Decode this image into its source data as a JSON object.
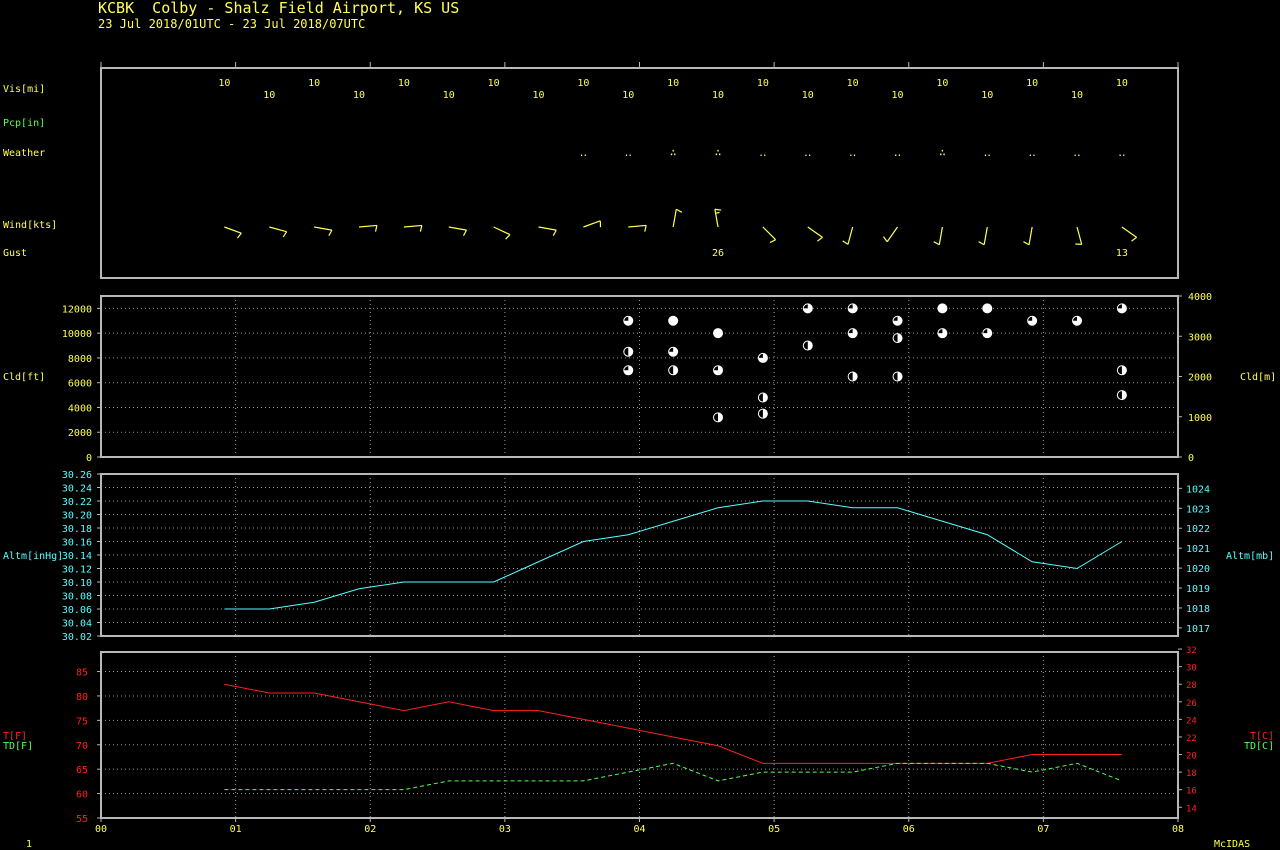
{
  "header": {
    "title": "KCBK  Colby - Shalz Field Airport, KS US",
    "subtitle": "23 Jul 2018/01UTC - 23 Jul 2018/07UTC"
  },
  "footer": {
    "left": "1",
    "right": "McIDAS"
  },
  "colors": {
    "yellow": "#ffff55",
    "green": "#55ff55",
    "cyan": "#55ffff",
    "red": "#ff2020",
    "frame": "#b8b8b8",
    "grid": "#9a9a9a"
  },
  "chart_data": {
    "type": "meteogram",
    "x": {
      "ticks": [
        "00",
        "01",
        "02",
        "03",
        "04",
        "05",
        "06",
        "07",
        "08"
      ],
      "obs_times": [
        0.9167,
        1.25,
        1.5833,
        1.9167,
        2.25,
        2.5833,
        2.9167,
        3.25,
        3.5833,
        3.9167,
        4.25,
        4.5833,
        4.9167,
        5.25,
        5.5833,
        5.9167,
        6.25,
        6.5833,
        6.9167,
        7.25,
        7.5833
      ]
    },
    "panels": {
      "surface": {
        "labels": {
          "vis": "Vis[mi]",
          "pcp": "Pcp[in]",
          "weather": "Weather",
          "wind": "Wind[kts]",
          "gust": "Gust"
        },
        "vis": [
          10,
          10,
          10,
          10,
          10,
          10,
          10,
          10,
          10,
          10,
          10,
          10,
          10,
          10,
          10,
          10,
          10,
          10,
          10,
          10,
          10
        ],
        "weather_symbols": [
          "",
          "",
          "",
          "",
          "",
          "",
          "",
          "",
          "‥",
          "‥",
          "∴",
          "∴",
          "‥",
          "‥",
          "‥",
          "‥",
          "∴",
          "‥",
          "‥",
          "‥",
          "‥"
        ],
        "wind_dir": [
          110,
          105,
          100,
          85,
          85,
          100,
          115,
          100,
          70,
          85,
          10,
          350,
          135,
          125,
          195,
          215,
          190,
          190,
          190,
          165,
          125
        ],
        "wind_spd": [
          10,
          10,
          10,
          10,
          10,
          10,
          10,
          10,
          10,
          10,
          10,
          15,
          10,
          10,
          10,
          10,
          10,
          10,
          10,
          10,
          10
        ],
        "gust": [
          "",
          "",
          "",
          "",
          "",
          "",
          "",
          "",
          "",
          "",
          "",
          "26",
          "",
          "",
          "",
          "",
          "",
          "",
          "",
          "",
          "13"
        ]
      },
      "cloud": {
        "ylabel_left": "Cld[ft]",
        "ylabel_right": "Cld[m]",
        "ylim_ft": [
          0,
          13000
        ],
        "ylim_m": [
          0,
          4000
        ],
        "ticks_ft": [
          "0",
          "2000",
          "4000",
          "6000",
          "8000",
          "10000",
          "12000"
        ],
        "ticks_m": [
          "0",
          "1000",
          "2000",
          "3000",
          "4000"
        ],
        "layers": [
          {
            "t": 3.9167,
            "ft": 7000,
            "cover": "bkn"
          },
          {
            "t": 3.9167,
            "ft": 8500,
            "cover": "sct"
          },
          {
            "t": 3.9167,
            "ft": 11000,
            "cover": "bkn"
          },
          {
            "t": 4.25,
            "ft": 7000,
            "cover": "sct"
          },
          {
            "t": 4.25,
            "ft": 8500,
            "cover": "bkn"
          },
          {
            "t": 4.25,
            "ft": 11000,
            "cover": "ovc"
          },
          {
            "t": 4.5833,
            "ft": 3200,
            "cover": "sct"
          },
          {
            "t": 4.5833,
            "ft": 7000,
            "cover": "bkn"
          },
          {
            "t": 4.5833,
            "ft": 10000,
            "cover": "ovc"
          },
          {
            "t": 4.9167,
            "ft": 3500,
            "cover": "sct"
          },
          {
            "t": 4.9167,
            "ft": 4800,
            "cover": "sct"
          },
          {
            "t": 4.9167,
            "ft": 8000,
            "cover": "bkn"
          },
          {
            "t": 5.25,
            "ft": 9000,
            "cover": "sct"
          },
          {
            "t": 5.25,
            "ft": 12000,
            "cover": "bkn"
          },
          {
            "t": 5.5833,
            "ft": 6500,
            "cover": "sct"
          },
          {
            "t": 5.5833,
            "ft": 10000,
            "cover": "bkn"
          },
          {
            "t": 5.5833,
            "ft": 12000,
            "cover": "bkn"
          },
          {
            "t": 5.9167,
            "ft": 6500,
            "cover": "sct"
          },
          {
            "t": 5.9167,
            "ft": 9600,
            "cover": "sct"
          },
          {
            "t": 5.9167,
            "ft": 11000,
            "cover": "bkn"
          },
          {
            "t": 6.25,
            "ft": 10000,
            "cover": "bkn"
          },
          {
            "t": 6.25,
            "ft": 12000,
            "cover": "ovc"
          },
          {
            "t": 6.5833,
            "ft": 10000,
            "cover": "bkn"
          },
          {
            "t": 6.5833,
            "ft": 12000,
            "cover": "ovc"
          },
          {
            "t": 6.9167,
            "ft": 11000,
            "cover": "bkn"
          },
          {
            "t": 7.25,
            "ft": 11000,
            "cover": "bkn"
          },
          {
            "t": 7.5833,
            "ft": 5000,
            "cover": "sct"
          },
          {
            "t": 7.5833,
            "ft": 7000,
            "cover": "sct"
          },
          {
            "t": 7.5833,
            "ft": 12000,
            "cover": "bkn"
          }
        ]
      },
      "altimeter": {
        "ylabel_left": "Altm[inHg]",
        "ylabel_right": "Altm[mb]",
        "ylim": [
          30.02,
          30.26
        ],
        "ticks_left": [
          "30.02",
          "30.04",
          "30.06",
          "30.08",
          "30.10",
          "30.12",
          "30.14",
          "30.16",
          "30.18",
          "30.20",
          "30.22",
          "30.24",
          "30.26"
        ],
        "ticks_right": [
          "1017",
          "1018",
          "1019",
          "1020",
          "1021",
          "1022",
          "1023",
          "1024"
        ],
        "mb_values": [
          1017,
          1018,
          1019,
          1020,
          1021,
          1022,
          1023,
          1024
        ],
        "values": [
          30.06,
          30.06,
          30.07,
          30.09,
          30.1,
          30.1,
          30.1,
          30.13,
          30.16,
          30.17,
          30.19,
          30.21,
          30.22,
          30.22,
          30.21,
          30.21,
          30.19,
          30.17,
          30.13,
          30.12,
          30.16
        ]
      },
      "temperature": {
        "ylabel_left_t": "T[F]",
        "ylabel_left_td": "TD[F]",
        "ylabel_right_t": "T[C]",
        "ylabel_right_td": "TD[C]",
        "ylim_f": [
          55,
          89
        ],
        "ticks_f": [
          "55",
          "60",
          "65",
          "70",
          "75",
          "80",
          "85"
        ],
        "ticks_c": [
          "14",
          "16",
          "18",
          "20",
          "22",
          "24",
          "26",
          "28",
          "30",
          "32"
        ],
        "series": [
          {
            "name": "T",
            "values": [
              82.4,
              80.6,
              80.6,
              78.8,
              77.0,
              78.8,
              77.0,
              77.0,
              75.2,
              73.4,
              71.6,
              69.8,
              66.2,
              66.2,
              66.2,
              66.2,
              66.2,
              66.2,
              68.0,
              68.0,
              68.0
            ]
          },
          {
            "name": "TD",
            "values": [
              60.8,
              60.8,
              60.8,
              60.8,
              60.8,
              62.6,
              62.6,
              62.6,
              62.6,
              64.4,
              66.2,
              62.6,
              64.4,
              64.4,
              64.4,
              66.2,
              66.2,
              66.2,
              64.4,
              66.2,
              62.6
            ]
          }
        ]
      }
    }
  }
}
